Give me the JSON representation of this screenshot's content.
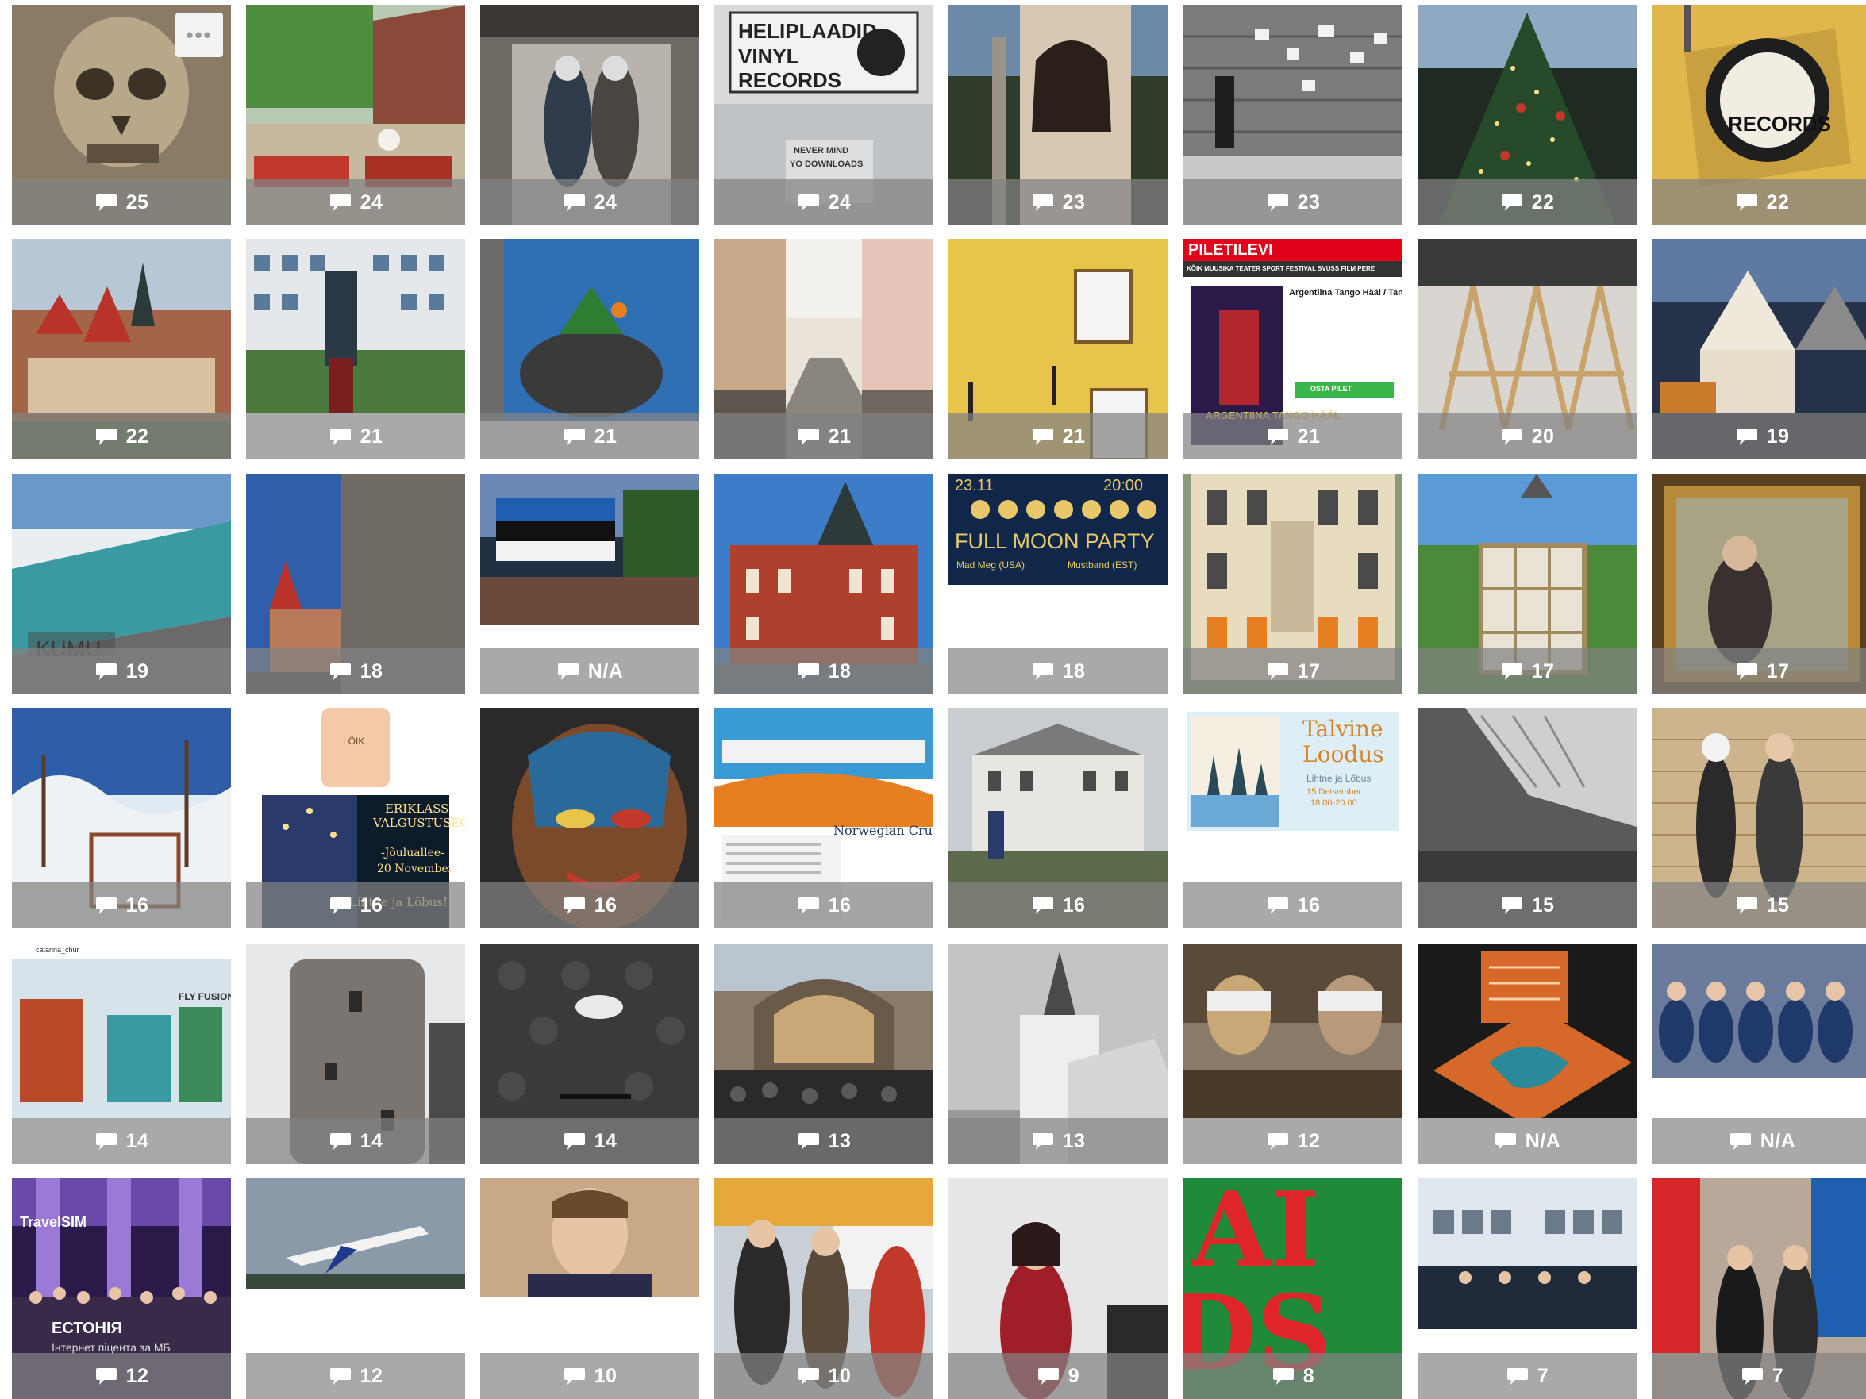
{
  "more_label": "•••",
  "tiles": [
    {
      "count": "25",
      "bar": "overlay",
      "img": "skull-rock"
    },
    {
      "count": "24",
      "bar": "overlay",
      "img": "cafe-terrace"
    },
    {
      "count": "24",
      "bar": "overlay",
      "img": "street-art-couple"
    },
    {
      "count": "24",
      "bar": "overlay",
      "img": "vinyl-shop-sign"
    },
    {
      "count": "23",
      "bar": "overlay",
      "img": "girl-mural-pole"
    },
    {
      "count": "23",
      "bar": "overlay",
      "img": "stone-wall-notes"
    },
    {
      "count": "22",
      "bar": "overlay",
      "img": "christmas-tree"
    },
    {
      "count": "22",
      "bar": "overlay",
      "img": "records-sign"
    },
    {
      "count": "22",
      "bar": "overlay",
      "img": "old-town-panorama"
    },
    {
      "count": "21",
      "bar": "solid",
      "img": "statue-building"
    },
    {
      "count": "21",
      "bar": "overlay",
      "img": "boar-mural"
    },
    {
      "count": "21",
      "bar": "overlay",
      "img": "cobbled-street"
    },
    {
      "count": "21",
      "bar": "overlay",
      "img": "yellow-house-lamps"
    },
    {
      "count": "21",
      "bar": "overlay",
      "img": "piletilevi-page"
    },
    {
      "count": "20",
      "bar": "overlay",
      "img": "wooden-easels"
    },
    {
      "count": "19",
      "bar": "overlay",
      "img": "town-square-market"
    },
    {
      "count": "19",
      "bar": "overlay",
      "img": "kumu-museum"
    },
    {
      "count": "18",
      "bar": "overlay",
      "img": "tower-wall-graffiti"
    },
    {
      "count": "N/A",
      "bar": "solid",
      "img": "flag-crowd"
    },
    {
      "count": "18",
      "bar": "overlay",
      "img": "red-brick-building"
    },
    {
      "count": "18",
      "bar": "solid",
      "img": "full-moon-poster"
    },
    {
      "count": "17",
      "bar": "overlay",
      "img": "facade-windows"
    },
    {
      "count": "17",
      "bar": "overlay",
      "img": "garden-door"
    },
    {
      "count": "17",
      "bar": "overlay",
      "img": "framed-painting"
    },
    {
      "count": "16",
      "bar": "overlay",
      "img": "snowy-park"
    },
    {
      "count": "16",
      "bar": "overlay",
      "img": "candle-workshop"
    },
    {
      "count": "16",
      "bar": "overlay",
      "img": "face-mural"
    },
    {
      "count": "16",
      "bar": "overlay",
      "img": "cruise-flyer"
    },
    {
      "count": "16",
      "bar": "overlay",
      "img": "wooden-villa"
    },
    {
      "count": "16",
      "bar": "solid",
      "img": "watercolor-poster"
    },
    {
      "count": "15",
      "bar": "overlay",
      "img": "gallery-interior"
    },
    {
      "count": "15",
      "bar": "overlay",
      "img": "skeleton-mural"
    },
    {
      "count": "14",
      "bar": "solid",
      "img": "fly-fusion-art"
    },
    {
      "count": "14",
      "bar": "overlay",
      "img": "round-tower"
    },
    {
      "count": "14",
      "bar": "overlay",
      "img": "mask-backdrop"
    },
    {
      "count": "13",
      "bar": "overlay",
      "img": "railway-station"
    },
    {
      "count": "13",
      "bar": "overlay",
      "img": "church-tower"
    },
    {
      "count": "12",
      "bar": "solid",
      "img": "blindfold-performers"
    },
    {
      "count": "N/A",
      "bar": "solid",
      "img": "cake-map"
    },
    {
      "count": "N/A",
      "bar": "solid",
      "img": "student-audience"
    },
    {
      "count": "12",
      "bar": "overlay",
      "img": "travelsim-concert"
    },
    {
      "count": "12",
      "bar": "solid",
      "img": "airplane-takeoff"
    },
    {
      "count": "10",
      "bar": "solid",
      "img": "man-portrait"
    },
    {
      "count": "10",
      "bar": "overlay",
      "img": "street-crowd"
    },
    {
      "count": "9",
      "bar": "overlay",
      "img": "singer-red-dress"
    },
    {
      "count": "8",
      "bar": "overlay",
      "img": "aids-poster"
    },
    {
      "count": "7",
      "bar": "solid",
      "img": "conference-panel"
    },
    {
      "count": "7",
      "bar": "overlay",
      "img": "flags-couple"
    }
  ],
  "overlays": {
    "vinyl_line1": "HELIPLAADID",
    "vinyl_line2": "VINYL",
    "vinyl_line3": "RECORDS",
    "vinyl_window": "NEVER MIND",
    "vinyl_window2": "YO DOWNLOADS",
    "records": "RECORDS",
    "piletilevi": "PILETILEVI",
    "piletilevi_nav": "KÕIK  MUUSIKA  TEATER  SPORT  FESTIVAL  SVUSS  FILM  PERE",
    "piletilevi_title": "Argentiina Tango Hääl / Tan",
    "piletilevi_poster": "ARGENTIINA TANGO HÄÄL",
    "piletilevi_buy": "OSTA PILET",
    "kumu": "KUMU",
    "moon_date": "23.11",
    "moon_time": "20:00",
    "moon_title": "FULL MOON PARTY",
    "moon_sub1": "Mad Meg (USA)",
    "moon_sub2": "Mustband (EST)",
    "candle_brand": "LÕIK",
    "candle_title1": "ERIKLASS",
    "candle_title2": "VALGUSTUSEGA",
    "candle_sub1": "-Jõuluallee-",
    "candle_sub2": "20 November",
    "candle_sub3": "Lihtne ja Lõbus!",
    "cruise_title": "Norwegian Cruise",
    "water_title1": "Talvine",
    "water_title2": "Loodus",
    "water_sub": "Lihtne ja Lõbus",
    "water_date": "15 Detsember",
    "water_time": "18.00-20.00",
    "fly_handle": "catarina_chur",
    "fly_brand": "FLY FUSION",
    "travelsim": "TravelSIM",
    "travelsim_country": "ЕСТОНІЯ",
    "travelsim_sub": "Інтернет пiцента за МБ",
    "aids_letters": "AIDS"
  }
}
